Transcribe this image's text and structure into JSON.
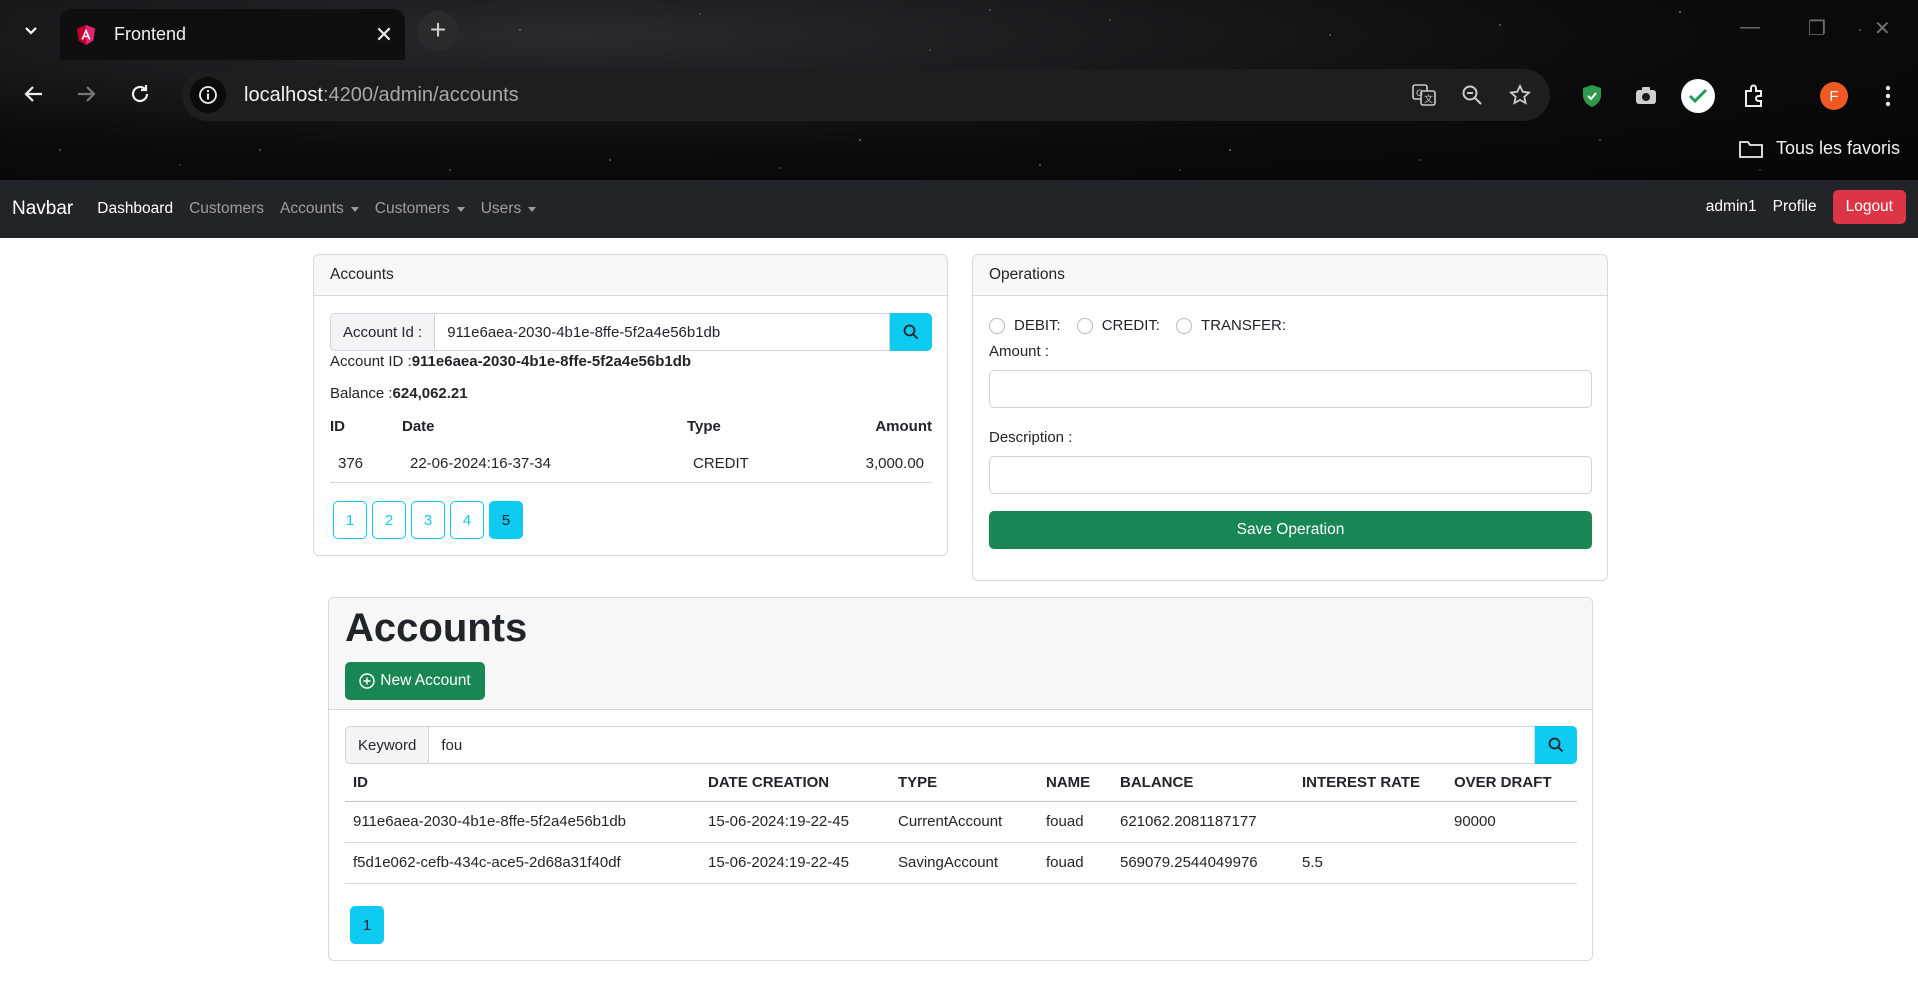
{
  "browser": {
    "tab_title": "Frontend",
    "url_host": "localhost",
    "url_rest": ":4200/admin/accounts",
    "bookmarks_label": "Tous les favoris",
    "profile_initial": "F"
  },
  "navbar": {
    "brand": "Navbar",
    "links": [
      "Dashboard",
      "Customers",
      "Accounts",
      "Customers",
      "Users"
    ],
    "user": "admin1",
    "profile": "Profile",
    "logout": "Logout"
  },
  "accounts_card": {
    "header": "Accounts",
    "search_label": "Account Id :",
    "search_value": "911e6aea-2030-4b1e-8ffe-5f2a4e56b1db",
    "account_id_label": "Account ID :",
    "account_id_value": "911e6aea-2030-4b1e-8ffe-5f2a4e56b1db",
    "balance_label": "Balance :",
    "balance_value": "624,062.21",
    "columns": [
      "ID",
      "Date",
      "Type",
      "Amount"
    ],
    "rows": [
      {
        "id": "376",
        "date": "22-06-2024:16-37-34",
        "type": "CREDIT",
        "amount": "3,000.00"
      }
    ],
    "pages": [
      "1",
      "2",
      "3",
      "4",
      "5"
    ],
    "active_page": "5"
  },
  "operations_card": {
    "header": "Operations",
    "radio_options": [
      "DEBIT:",
      "CREDIT:",
      "TRANSFER:"
    ],
    "amount_label": "Amount :",
    "description_label": "Description :",
    "save_button": "Save Operation"
  },
  "accounts_list": {
    "title": "Accounts",
    "new_button": "New Account",
    "keyword_label": "Keyword",
    "keyword_value": "fou",
    "columns": [
      "ID",
      "DATE CREATION",
      "TYPE",
      "NAME",
      "BALANCE",
      "INTEREST RATE",
      "OVER DRAFT"
    ],
    "rows": [
      {
        "id": "911e6aea-2030-4b1e-8ffe-5f2a4e56b1db",
        "date": "15-06-2024:19-22-45",
        "type": "CurrentAccount",
        "name": "fouad",
        "balance": "621062.2081187177",
        "interest": "",
        "overdraft": "90000"
      },
      {
        "id": "f5d1e062-cefb-434c-ace5-2d68a31f40df",
        "date": "15-06-2024:19-22-45",
        "type": "SavingAccount",
        "name": "fouad",
        "balance": "569079.2544049976",
        "interest": "5.5",
        "overdraft": ""
      }
    ],
    "pages": [
      "1"
    ]
  },
  "colors": {
    "navbar_bg": "#212529",
    "info": "#0dcaf0",
    "success": "#198754",
    "danger": "#dc3545"
  }
}
